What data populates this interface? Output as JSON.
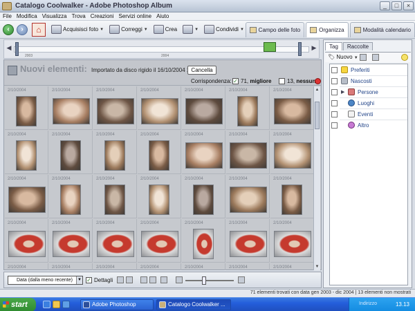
{
  "window": {
    "title": "Catalogo Coolwalker - Adobe Photoshop Album"
  },
  "menu": [
    "File",
    "Modifica",
    "Visualizza",
    "Trova",
    "Creazioni",
    "Servizi online",
    "Aiuto"
  ],
  "toolbar": {
    "acquire": "Acquisisci foto",
    "fix": "Correggi",
    "create": "Crea",
    "share": "Condividi"
  },
  "tabs": {
    "photo_well": "Campo delle foto",
    "organize": "Organizza",
    "calendar": "Modalità calendario"
  },
  "timeline": {
    "year_start": "2003",
    "year_end": "2004"
  },
  "import": {
    "title": "Nuovi elementi:",
    "description": "Importato da disco rigido il 16/10/2004 13.13",
    "cancel": "Cancella",
    "match_label": "Corrispondenza:",
    "best_count": "71,",
    "best_label": "migliore",
    "none_count": "13,",
    "none_label": "nessuna"
  },
  "grid": {
    "date": "2/10/2004",
    "rows": 5,
    "cols": 7
  },
  "bottom": {
    "sort": "Data (dalla meno recente)",
    "details": "Dettagli"
  },
  "right_panel": {
    "tabs": [
      "Tag",
      "Raccolte"
    ],
    "new_label": "Nuovo",
    "tags": [
      "Preferiti",
      "Nascosti",
      "Persone",
      "Luoghi",
      "Eventi",
      "Altro"
    ]
  },
  "status": {
    "text": "71 elementi trovati con data gen 2003 - dic 2004  |  13 elementi non mostrati"
  },
  "taskbar": {
    "start": "start",
    "tasks": [
      "Adobe Photoshop",
      "Catalogo Coolwalker ..."
    ],
    "tray_label": "Indirizzo",
    "clock": "13.13"
  },
  "colors": {
    "accent": "#2f8a2f",
    "taskbar": "#245edb"
  }
}
